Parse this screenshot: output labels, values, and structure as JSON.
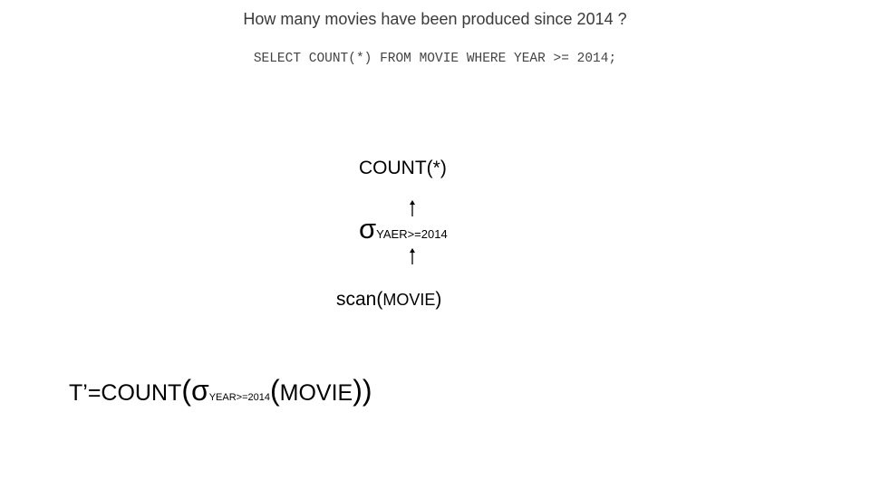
{
  "slide": {
    "question": "How many movies have been produced since 2014 ?",
    "sql": {
      "kw_select": "SELECT",
      "kw_count": "COUNT(*)",
      "kw_from": "FROM",
      "table": "MOVIE",
      "kw_where": "WHERE",
      "column": "YEAR",
      "condition": ">= 2014;"
    },
    "tree": {
      "root": "COUNT(*)",
      "select_symbol": "σ",
      "select_condition": "YAER>=2014",
      "scan_op": "scan(",
      "scan_table": "MOVIE",
      "scan_close": ")"
    },
    "formula": {
      "prefix": "T’=COUNT",
      "open_paren": "(",
      "sigma": "σ",
      "condition": "YEAR>=2014",
      "inner_open": "(",
      "table": "MOVIE",
      "close_parens": "))"
    }
  }
}
